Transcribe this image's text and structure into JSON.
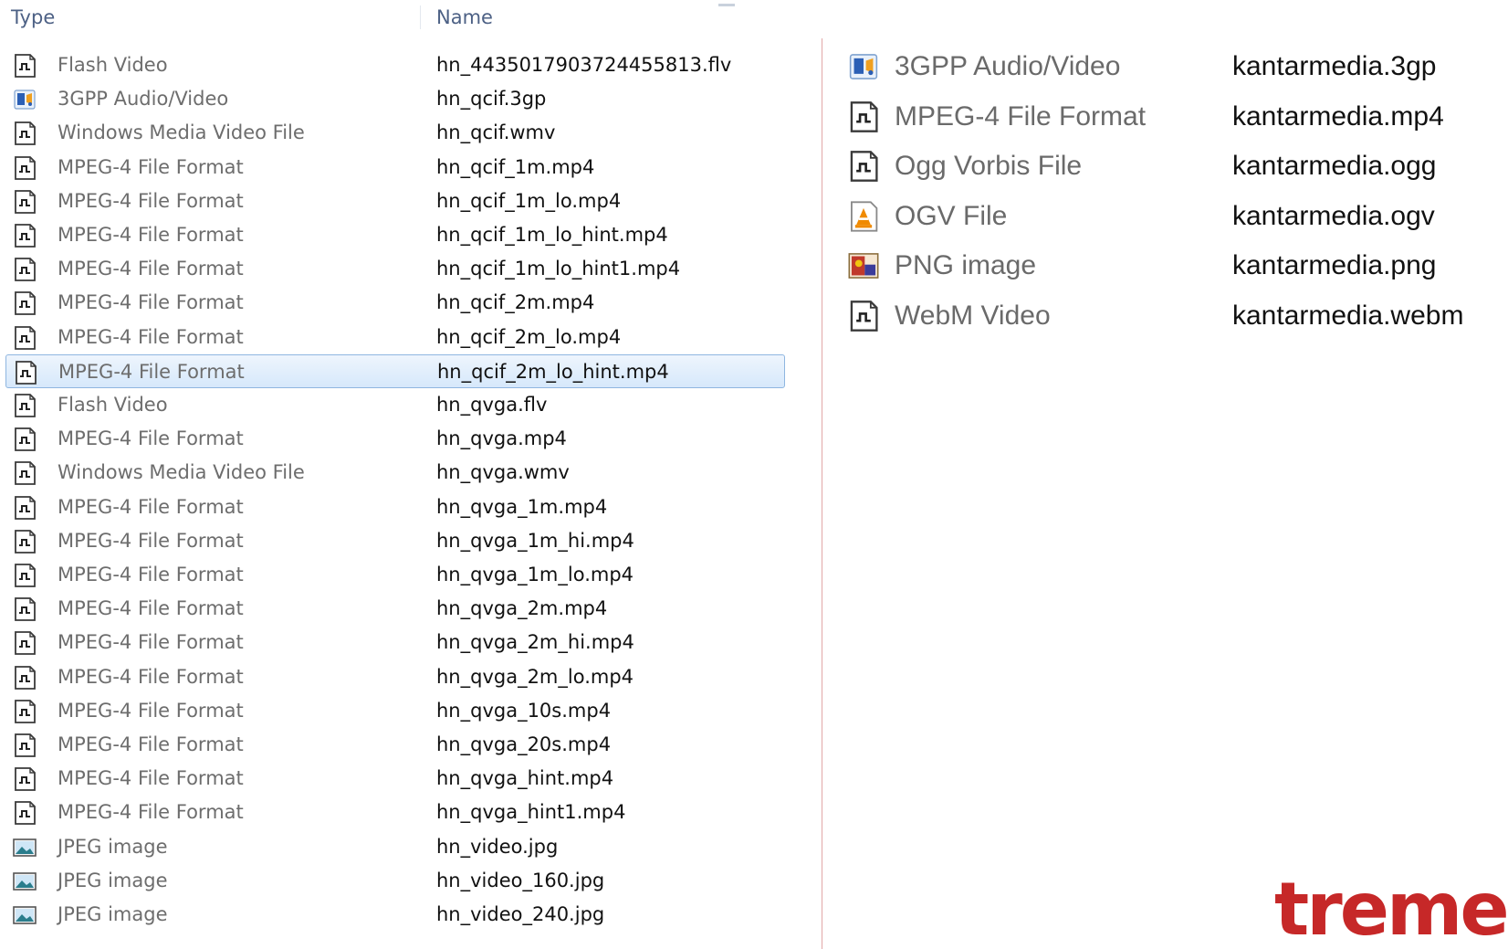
{
  "columns": {
    "type_header": "Type",
    "name_header": "Name"
  },
  "left_files": [
    {
      "icon": "media-file-icon",
      "type": "Flash Video",
      "name": "hn_4435017903724455813.flv"
    },
    {
      "icon": "3gpp-file-icon",
      "type": "3GPP Audio/Video",
      "name": "hn_qcif.3gp"
    },
    {
      "icon": "media-file-icon",
      "type": "Windows Media Video File",
      "name": "hn_qcif.wmv"
    },
    {
      "icon": "media-file-icon",
      "type": "MPEG-4 File Format",
      "name": "hn_qcif_1m.mp4"
    },
    {
      "icon": "media-file-icon",
      "type": "MPEG-4 File Format",
      "name": "hn_qcif_1m_lo.mp4"
    },
    {
      "icon": "media-file-icon",
      "type": "MPEG-4 File Format",
      "name": "hn_qcif_1m_lo_hint.mp4"
    },
    {
      "icon": "media-file-icon",
      "type": "MPEG-4 File Format",
      "name": "hn_qcif_1m_lo_hint1.mp4"
    },
    {
      "icon": "media-file-icon",
      "type": "MPEG-4 File Format",
      "name": "hn_qcif_2m.mp4"
    },
    {
      "icon": "media-file-icon",
      "type": "MPEG-4 File Format",
      "name": "hn_qcif_2m_lo.mp4"
    },
    {
      "icon": "media-file-icon",
      "type": "MPEG-4 File Format",
      "name": "hn_qcif_2m_lo_hint.mp4",
      "selected": true
    },
    {
      "icon": "media-file-icon",
      "type": "Flash Video",
      "name": "hn_qvga.flv"
    },
    {
      "icon": "media-file-icon",
      "type": "MPEG-4 File Format",
      "name": "hn_qvga.mp4"
    },
    {
      "icon": "media-file-icon",
      "type": "Windows Media Video File",
      "name": "hn_qvga.wmv"
    },
    {
      "icon": "media-file-icon",
      "type": "MPEG-4 File Format",
      "name": "hn_qvga_1m.mp4"
    },
    {
      "icon": "media-file-icon",
      "type": "MPEG-4 File Format",
      "name": "hn_qvga_1m_hi.mp4"
    },
    {
      "icon": "media-file-icon",
      "type": "MPEG-4 File Format",
      "name": "hn_qvga_1m_lo.mp4"
    },
    {
      "icon": "media-file-icon",
      "type": "MPEG-4 File Format",
      "name": "hn_qvga_2m.mp4"
    },
    {
      "icon": "media-file-icon",
      "type": "MPEG-4 File Format",
      "name": "hn_qvga_2m_hi.mp4"
    },
    {
      "icon": "media-file-icon",
      "type": "MPEG-4 File Format",
      "name": "hn_qvga_2m_lo.mp4"
    },
    {
      "icon": "media-file-icon",
      "type": "MPEG-4 File Format",
      "name": "hn_qvga_10s.mp4"
    },
    {
      "icon": "media-file-icon",
      "type": "MPEG-4 File Format",
      "name": "hn_qvga_20s.mp4"
    },
    {
      "icon": "media-file-icon",
      "type": "MPEG-4 File Format",
      "name": "hn_qvga_hint.mp4"
    },
    {
      "icon": "media-file-icon",
      "type": "MPEG-4 File Format",
      "name": "hn_qvga_hint1.mp4"
    },
    {
      "icon": "jpeg-image-icon",
      "type": "JPEG image",
      "name": "hn_video.jpg"
    },
    {
      "icon": "jpeg-image-icon",
      "type": "JPEG image",
      "name": "hn_video_160.jpg"
    },
    {
      "icon": "jpeg-image-icon",
      "type": "JPEG image",
      "name": "hn_video_240.jpg"
    }
  ],
  "right_files": [
    {
      "icon": "3gpp-file-icon",
      "type": "3GPP Audio/Video",
      "name": "kantarmedia.3gp"
    },
    {
      "icon": "media-file-icon",
      "type": "MPEG-4 File Format",
      "name": "kantarmedia.mp4"
    },
    {
      "icon": "media-file-icon",
      "type": "Ogg Vorbis File",
      "name": "kantarmedia.ogg"
    },
    {
      "icon": "vlc-file-icon",
      "type": "OGV File",
      "name": "kantarmedia.ogv"
    },
    {
      "icon": "png-image-icon",
      "type": "PNG image",
      "name": "kantarmedia.png"
    },
    {
      "icon": "media-file-icon",
      "type": "WebM Video",
      "name": "kantarmedia.webm"
    }
  ],
  "logo": {
    "text": "tremen",
    "color": "#c62828"
  },
  "colors": {
    "type_text": "#6d6d6d",
    "name_text": "#111111",
    "header_text": "#4d6185",
    "selection_border": "#8fb6e0",
    "divider": "#e2a7a7"
  }
}
